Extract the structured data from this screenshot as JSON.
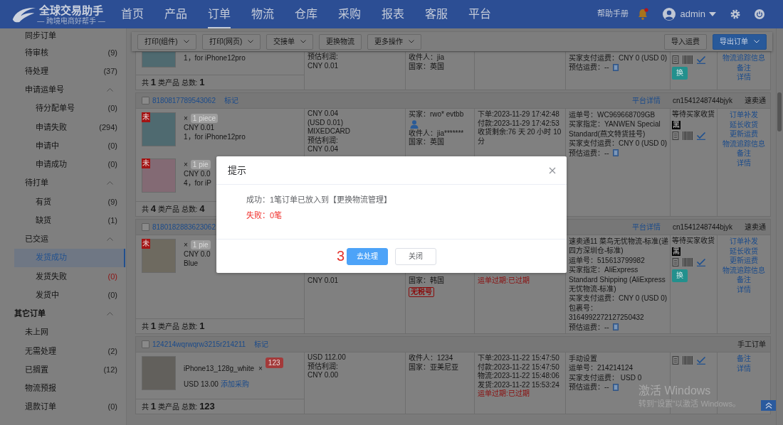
{
  "navbar": {
    "logo_title": "全球交易助手",
    "logo_subtitle": "— 跨境电商好帮手 —",
    "items": [
      {
        "label": "首页",
        "selected": false
      },
      {
        "label": "产品",
        "selected": false
      },
      {
        "label": "订单",
        "selected": true
      },
      {
        "label": "物流",
        "selected": false
      },
      {
        "label": "仓库",
        "selected": false
      },
      {
        "label": "采购",
        "selected": false
      },
      {
        "label": "报表",
        "selected": false
      },
      {
        "label": "客服",
        "selected": false
      },
      {
        "label": "平台",
        "selected": false
      }
    ],
    "help_link": "帮助手册",
    "has_unread": true,
    "user": "admin"
  },
  "sidebar": {
    "groups": [
      {
        "items": [
          {
            "label": "同步订单",
            "selected": false
          },
          {
            "label": "待审核",
            "count": "(9)",
            "warning": false,
            "selected": false
          },
          {
            "label": "待处理",
            "count": "(37)",
            "warning": false,
            "selected": false
          },
          {
            "label": "申请运单号",
            "expanded": true,
            "selected": false,
            "children": [
              {
                "label": "待分配单号",
                "count": "(0)",
                "warning": false,
                "selected": false
              },
              {
                "label": "申请失败",
                "count": "(294)",
                "warning": false,
                "selected": false
              },
              {
                "label": "申请中",
                "count": "(0)",
                "warning": false,
                "selected": false
              },
              {
                "label": "申请成功",
                "count": "(0)",
                "warning": false,
                "selected": false
              }
            ]
          },
          {
            "label": "待打单",
            "expanded": true,
            "selected": false,
            "children": [
              {
                "label": "有货",
                "count": "(9)",
                "warning": false,
                "selected": false
              },
              {
                "label": "缺货",
                "count": "(1)",
                "warning": false,
                "selected": false
              }
            ]
          },
          {
            "label": "已交运",
            "expanded": true,
            "selected": false,
            "children": [
              {
                "label": "发货成功",
                "selected": true
              },
              {
                "label": "发货失败",
                "count": "(0)",
                "warning": true,
                "selected": false
              },
              {
                "label": "发货中",
                "count": "(0)",
                "warning": false,
                "selected": false
              }
            ]
          }
        ]
      },
      {
        "label": "其它订单",
        "expanded": true,
        "items": [
          {
            "label": "未上网",
            "selected": false
          },
          {
            "label": "无需处理",
            "count": "(2)",
            "warning": false,
            "selected": false
          },
          {
            "label": "已搁置",
            "count": "(12)",
            "warning": false,
            "selected": false
          },
          {
            "label": "物流预报",
            "selected": false
          },
          {
            "label": "退款订单",
            "count": "(0)",
            "warning": false,
            "selected": false
          }
        ]
      }
    ]
  },
  "toolbar": {
    "left": [
      {
        "label": "打印(组件)",
        "dropdown": true
      },
      {
        "label": "打印(网页)",
        "dropdown": true
      },
      {
        "label": "交接单",
        "dropdown": true
      },
      {
        "label": "更换物流",
        "dropdown": false
      },
      {
        "label": "更多操作",
        "dropdown": true
      }
    ],
    "right": [
      {
        "label": "导入运费",
        "kind": "default",
        "dropdown": false
      },
      {
        "label": "导出订单",
        "kind": "primary",
        "dropdown": true
      }
    ]
  },
  "orders": [
    {
      "products": [
        {
          "variant": "1，for iPhone12pro"
        }
      ],
      "summary": "共 **1** 类产品 总数: **1**",
      "finance": [
        "预估利润:",
        "CNY 0.01"
      ],
      "buyer": {
        "recipient": "收件人：jia",
        "country": "国家：英国"
      },
      "shipping": {
        "lines": [
          "买家支付运费：CNY 0 (USD 0)"
        ],
        "estimate": "预估运费：--"
      },
      "status": {
        "swap": "换"
      },
      "actions": [
        "物流追踪信息",
        "备注",
        "详情"
      ]
    },
    {
      "header": {
        "checked": false,
        "number": "8180817789543062",
        "mark_link": "标记",
        "platform_link": "平台详情",
        "account": "cn1541248744bjyk",
        "platform": "速卖通"
      },
      "products": [
        {
          "tag": "未",
          "quantity_sign": "×",
          "quantity": "1 piece",
          "quantity_alert": false,
          "price": "CNY 0.01",
          "variant": "1，for iPhone12pro"
        },
        {
          "tag": "未",
          "quantity_sign": "×",
          "quantity": "1 pie",
          "quantity_alert": false,
          "price": "CNY 0.0",
          "variant": "4，for iP"
        }
      ],
      "summary": "共 **4** 类产品 总数: **4**",
      "finance": [
        "CNY 0.04",
        "(USD 0.01)",
        "MIXEDCARD",
        "预估利润:",
        "CNY 0.04"
      ],
      "buyer": {
        "buyer": "买家：rwo* evtbb",
        "profile_icon": true,
        "recipient": "收件人：jia*******",
        "country": "国家：英国"
      },
      "times": [
        {
          "text": "下单:2023-11-29 17:42:48",
          "alert": false
        },
        {
          "text": "付款:2023-11-29 17:42:53",
          "alert": false
        },
        {
          "text": "收货剩余:76 天 20 小时 10 分",
          "alert": false
        }
      ],
      "shipping": {
        "lines": [
          "运单号：WC969668709GB",
          "买家指定：YANWEN Special Standard(燕文特货挂号)",
          "买家支付运费：CNY 0 (USD 0)"
        ],
        "estimate": "预估运费：--"
      },
      "status": {
        "text": "等待买家收货",
        "tag": "黑"
      },
      "actions": [
        "订单补发",
        "延长收货",
        "更新运费",
        "物流追踪信息",
        "备注",
        "详情"
      ]
    },
    {
      "header": {
        "checked": false,
        "number": "8180182883623062",
        "platform_link": "平台详情",
        "account": "cn1541248744bjyk",
        "platform": "速卖通"
      },
      "products": [
        {
          "tag": "未",
          "quantity_sign": "×",
          "quantity": "1 pie",
          "quantity_alert": false,
          "price": "CNY 0.0",
          "variant": "Blue"
        }
      ],
      "summary": "共 **1** 类产品 总数: **1**",
      "finance": [
        "CNY 0.01"
      ],
      "buyer": {
        "country": "国家：韩国",
        "tax_tag": "无税号"
      },
      "times": [
        {
          "text": "运单过期:已过期",
          "alert": true
        }
      ],
      "shipping": {
        "lines": [
          "速卖通11 菜鸟无忧物流-标准(递四方深圳仓-标准)",
          "运单号：515613799982",
          "买家指定：AliExpress Standard Shipping (AliExpress无忧物流-标准)",
          "买家支付运费：CNY 0 (USD 0)",
          "包裹号：3164992272127250432"
        ],
        "estimate": "预估运费：--"
      },
      "status": {
        "text": "等待买家收货",
        "tag": "黑",
        "swap": "换"
      },
      "actions": [
        "订单补发",
        "延长收货",
        "更新运费",
        "物流追踪信息",
        "备注",
        "详情"
      ]
    },
    {
      "header": {
        "checked": false,
        "number": "124214wqrwqrw3215r214211",
        "mark_link": "标记",
        "platform": "手工订单"
      },
      "products": [
        {
          "name": "iPhone13_128g_white",
          "quantity_sign": "×",
          "quantity": "123",
          "quantity_alert": true,
          "price": "USD 13.00",
          "purchase_link": "添加采购"
        }
      ],
      "summary": "共 **1** 类产品 总数: **123**",
      "finance": [
        "USD 112.00",
        "预估利润:",
        "CNY 0.00"
      ],
      "buyer": {
        "recipient": "收件人：1234",
        "country": "国家：亚美尼亚"
      },
      "times": [
        {
          "text": "下单:2023-11-22 15:47:50",
          "alert": false
        },
        {
          "text": "付款:2023-11-22 15:47:50",
          "alert": false
        },
        {
          "text": "物流:2023-11-22 15:48:06",
          "alert": false
        },
        {
          "text": "发货:2023-11-22 15:53:24",
          "alert": false
        },
        {
          "text": "运单过期:已过期",
          "alert": true
        }
      ],
      "shipping": {
        "lines": [
          "手动设置",
          "运单号：214214124",
          "买家支付运费： USD 0"
        ],
        "estimate": "预估运费：--"
      },
      "actions": [
        "备注",
        "详情"
      ]
    }
  ],
  "dialog": {
    "title": "提示",
    "messages": [
      {
        "kind": "success",
        "text": "成功：1笔订单已放入到【更换物流管理】"
      },
      {
        "kind": "failure",
        "text": "失败：0笔"
      }
    ],
    "annotation": "3",
    "buttons": [
      {
        "label": "去处理",
        "kind": "primary"
      },
      {
        "label": "关闭",
        "kind": "default"
      }
    ]
  },
  "os_notice": {
    "title": "激活 Windows",
    "text": "转到“设置”以激活 Windows。"
  }
}
